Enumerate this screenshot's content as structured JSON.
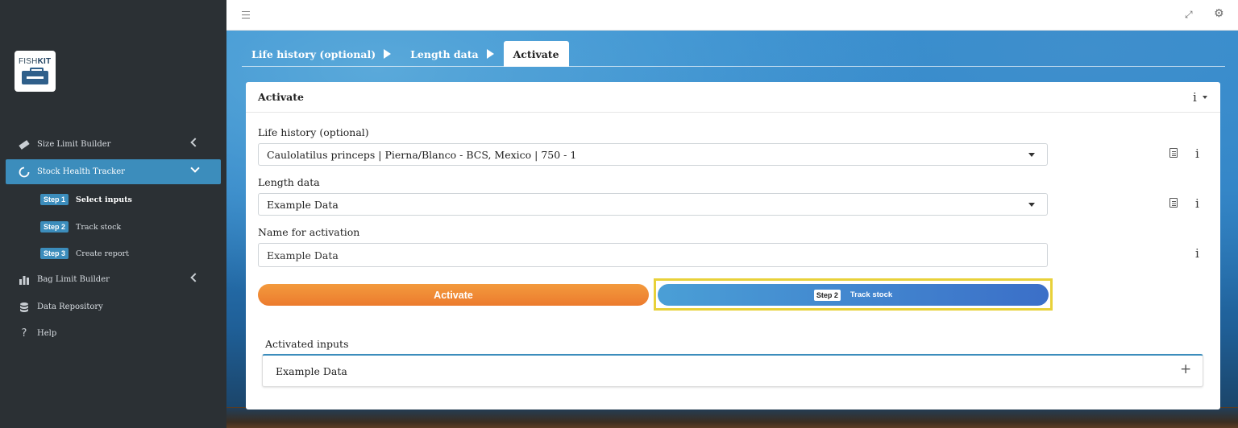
{
  "logo": {
    "text_light": "FISH",
    "text_bold": "KIT"
  },
  "sidebar": {
    "items": [
      {
        "label": "Size Limit Builder",
        "icon": "ruler-icon"
      },
      {
        "label": "Stock Health Tracker",
        "icon": "circle-notch-icon",
        "active": true
      },
      {
        "label": "Bag Limit Builder",
        "icon": "bar-chart-icon"
      },
      {
        "label": "Data Repository",
        "icon": "database-icon"
      },
      {
        "label": "Help",
        "icon": "question-icon"
      }
    ],
    "subitems": [
      {
        "badge": "Step 1",
        "label": "Select inputs",
        "current": true
      },
      {
        "badge": "Step 2",
        "label": "Track stock"
      },
      {
        "badge": "Step 3",
        "label": "Create report"
      }
    ]
  },
  "topbar": {
    "menu_icon": "hamburger-icon",
    "expand_icon": "expand-icon",
    "settings_icon": "gear-icon"
  },
  "tabs": [
    {
      "label": "Life history (optional)"
    },
    {
      "label": "Length data"
    },
    {
      "label": "Activate",
      "active": true
    }
  ],
  "card": {
    "title": "Activate",
    "info_label": "i",
    "fields": {
      "life_history": {
        "label": "Life history (optional)",
        "value": "Caulolatilus princeps | Pierna/Blanco - BCS, Mexico | 750 - 1"
      },
      "length_data": {
        "label": "Length data",
        "value": "Example Data"
      },
      "name": {
        "label": "Name for activation",
        "value": "Example Data"
      }
    },
    "buttons": {
      "activate": "Activate",
      "track_badge": "Step 2",
      "track_label": "Track stock"
    },
    "activated": {
      "title": "Activated inputs",
      "panel_title": "Example Data",
      "expand_symbol": "+"
    }
  },
  "colors": {
    "sidebar_bg": "#2b3034",
    "accent_blue": "#3c8dbc",
    "activate_orange": "#ef8533",
    "highlight_yellow": "#e8d13a"
  }
}
